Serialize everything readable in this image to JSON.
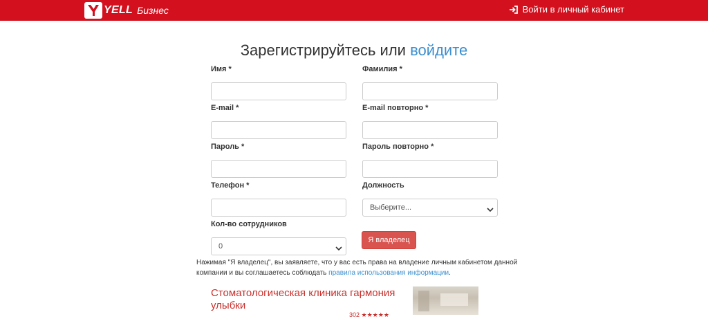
{
  "header": {
    "logo_word": "YELL",
    "logo_sub": "Бизнес",
    "login_label": "Войти в личный кабинет",
    "login_icon": "sign-in-icon",
    "brand_color": "#d2101e"
  },
  "heading": {
    "prefix": "Зарегистрируйтесь или",
    "link": "войдите"
  },
  "form": {
    "first_name_label": "Имя *",
    "last_name_label": "Фамилия *",
    "email_label": "E-mail *",
    "email_repeat_label": "E-mail повторно *",
    "password_label": "Пароль *",
    "password_repeat_label": "Пароль повторно *",
    "phone_label": "Телефон *",
    "position_label": "Должность",
    "position_selected": "Выберите...",
    "employees_label": "Кол-во сотрудников",
    "employees_selected": "0",
    "submit_label": "Я владелец",
    "submit_color": "#d9534f"
  },
  "notice": {
    "text": "Нажимая \"Я владелец\", вы заявляете, что у вас есть права на владение личным кабинетом данной компании и вы соглашаетесь соблюдать",
    "link": "правила использования информации",
    "tail": "."
  },
  "company": {
    "title": "Стоматологическая клиника гармония улыбки",
    "rating_count": "302",
    "stars": 5
  }
}
